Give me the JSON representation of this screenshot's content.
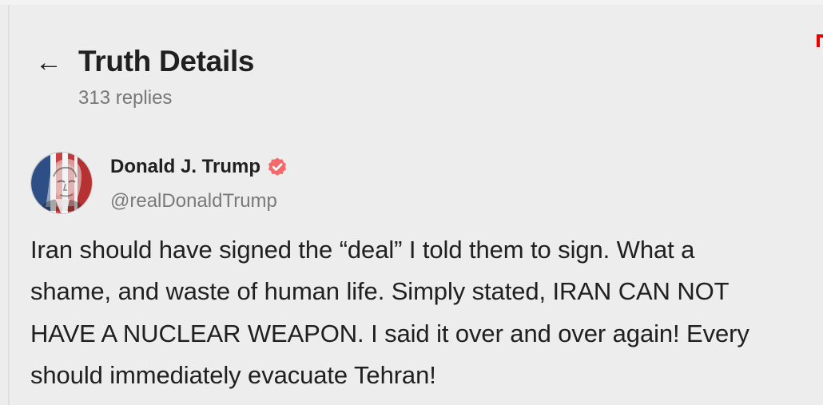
{
  "header": {
    "back_icon": "arrow-left-icon",
    "title": "Truth Details",
    "reply_count": "313 replies"
  },
  "post": {
    "author_name": "Donald J. Trump",
    "verified_icon": "verified-badge-icon",
    "verified_color": "#f46a6a",
    "handle": "@realDonaldTrump",
    "lines": [
      "Iran should have signed the “deal” I told them to sign. What a",
      "shame, and waste of human life. Simply stated, IRAN CAN NOT",
      "HAVE A NUCLEAR WEAPON. I said it over and over again! Every",
      "should immediately evacuate Tehran!"
    ]
  },
  "colors": {
    "background": "#ededed",
    "text": "#202020",
    "muted_text": "#777777",
    "accent_red": "#e60000"
  }
}
